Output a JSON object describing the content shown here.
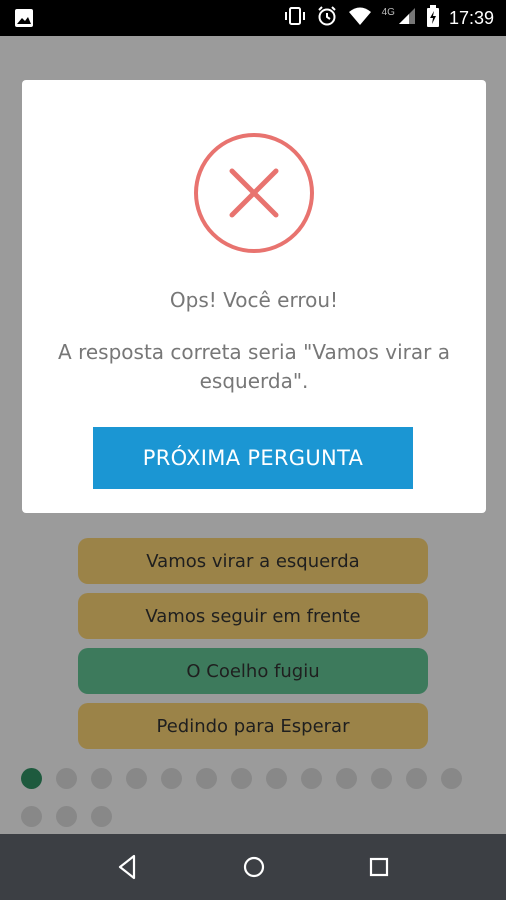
{
  "status_bar": {
    "time": "17:39",
    "network": "4G",
    "icons": [
      "image-icon",
      "vibrate-icon",
      "alarm-icon",
      "wifi-icon",
      "signal-icon",
      "battery-icon"
    ]
  },
  "dialog": {
    "icon": "error-x-icon",
    "title": "Ops! Você errou!",
    "message": "A resposta correta seria \"Vamos virar a esquerda\".",
    "next_button_label": "PRÓXIMA PERGUNTA",
    "colors": {
      "error": "#e8736f",
      "button": "#1b96d3"
    }
  },
  "answers": [
    {
      "label": "Vamos virar a esquerda",
      "state": "option"
    },
    {
      "label": "Vamos seguir em frente",
      "state": "option"
    },
    {
      "label": "O Coelho fugiu",
      "state": "selected"
    },
    {
      "label": "Pedindo para Esperar",
      "state": "option"
    }
  ],
  "progress": {
    "total_questions": 16,
    "current": 1
  },
  "nav_bar": {
    "icons": [
      "back-icon",
      "home-icon",
      "recents-icon"
    ]
  }
}
